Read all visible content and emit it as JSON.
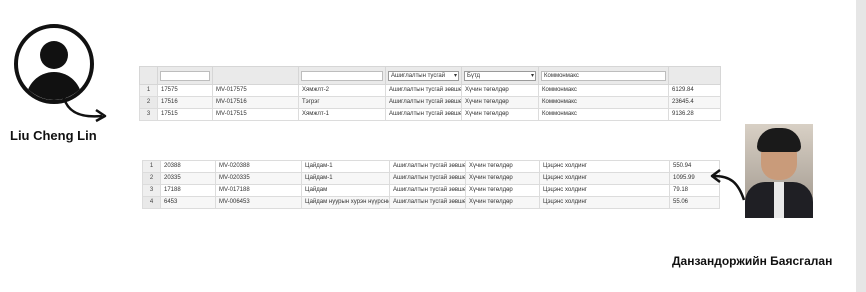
{
  "people": {
    "left_name": "Liu Cheng Lin",
    "right_name": "Данзандоржийн Баясгалан"
  },
  "table1": {
    "filters": {
      "col5_select": "Ашиглалтын тусгай",
      "col6_select": "Бүтд",
      "col7_text": "Коммонмакс"
    },
    "rows": [
      {
        "idx": "1",
        "code": "17575",
        "license": "MV-017575",
        "name": "Хямжлт-2",
        "type": "Ашиглалтын тусгай зөвшөө",
        "subtype": "Хүчин төгөлдөр",
        "company": "Коммонмакс",
        "area": "6129.84"
      },
      {
        "idx": "2",
        "code": "17516",
        "license": "MV-017516",
        "name": "Тэгрэг",
        "type": "Ашиглалтын тусгай зөвшөө",
        "subtype": "Хүчин төгөлдөр",
        "company": "Коммонмакс",
        "area": "23645.4"
      },
      {
        "idx": "3",
        "code": "17515",
        "license": "MV-017515",
        "name": "Хямжлт-1",
        "type": "Ашиглалтын тусгай зөвшөө",
        "subtype": "Хүчин төгөлдөр",
        "company": "Коммонмакс",
        "area": "9136.28"
      }
    ]
  },
  "table2": {
    "rows": [
      {
        "idx": "1",
        "code": "20388",
        "license": "MV-020388",
        "name": "Цайдам-1",
        "type": "Ашиглалтын тусгай зөвшөө",
        "subtype": "Хүчин төгөлдөр",
        "company": "Цэцэнс холдинг",
        "area": "550.94"
      },
      {
        "idx": "2",
        "code": "20335",
        "license": "MV-020335",
        "name": "Цайдам-1",
        "type": "Ашиглалтын тусгай зөвшөө",
        "subtype": "Хүчин төгөлдөр",
        "company": "Цэцэнс холдинг",
        "area": "1095.99"
      },
      {
        "idx": "3",
        "code": "17188",
        "license": "MV-017188",
        "name": "Цайдам",
        "type": "Ашиглалтын тусгай зөвшөө",
        "subtype": "Хүчин төгөлдөр",
        "company": "Цэцэнс холдинг",
        "area": "79.18"
      },
      {
        "idx": "4",
        "code": "6453",
        "license": "MV-006453",
        "name": "Цайдам нуурын хурэн нүүрсний",
        "type": "Ашиглалтын тусгай зөвшөө",
        "subtype": "Хүчин төгөлдөр",
        "company": "Цэцэнс холдинг",
        "area": "55.06"
      }
    ]
  }
}
